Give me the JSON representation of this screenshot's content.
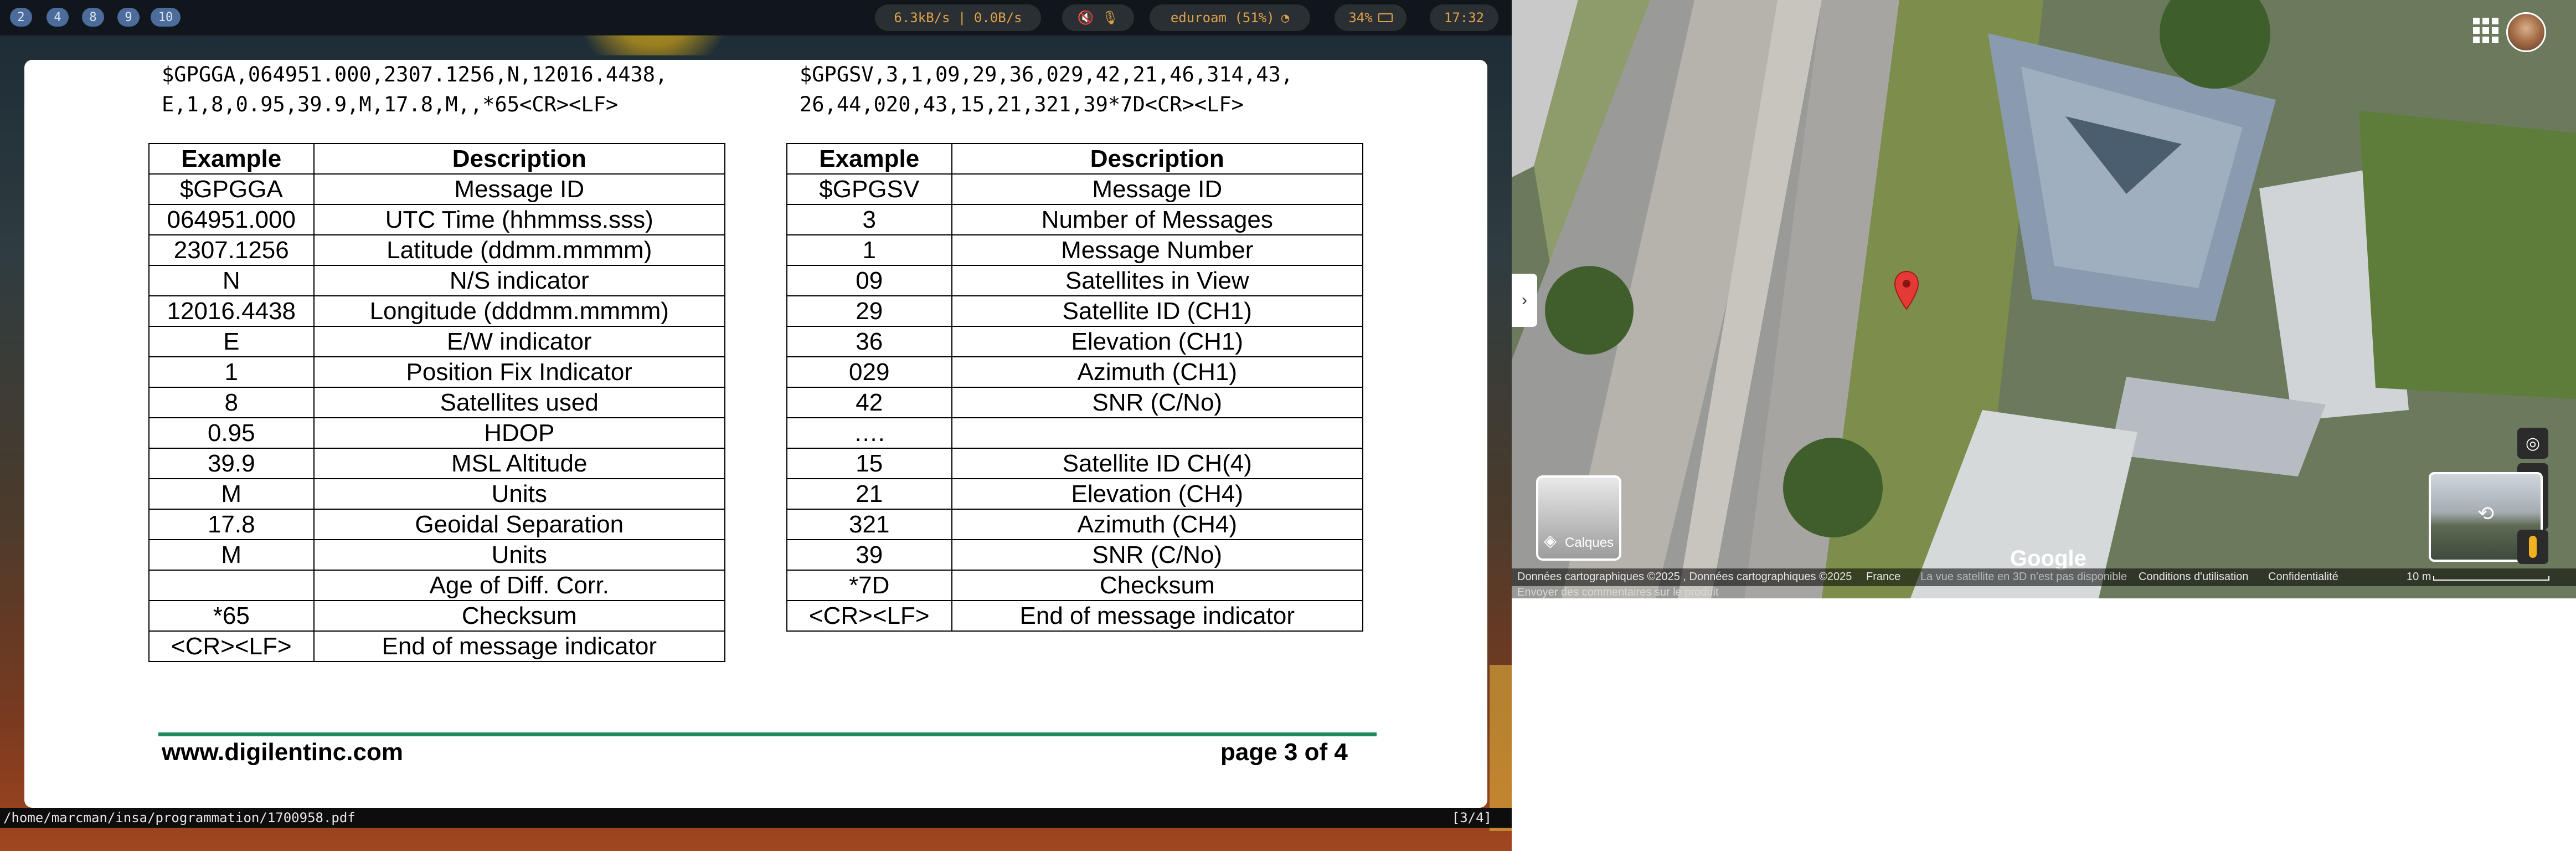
{
  "topbar": {
    "workspaces": [
      "2",
      "4",
      "8",
      "9",
      "10"
    ],
    "network_speed": "6.3kB/s | 0.0B/s",
    "wifi": "eduroam (51%)",
    "battery": "34%",
    "clock": "17:32"
  },
  "pdf": {
    "nmea_left": [
      "$GPGGA,064951.000,2307.1256,N,12016.4438,",
      "E,1,8,0.95,39.9,M,17.8,M,,*65<CR><LF>"
    ],
    "nmea_right": [
      "$GPGSV,3,1,09,29,36,029,42,21,46,314,43,",
      "26,44,020,43,15,21,321,39*7D<CR><LF>"
    ],
    "headers": {
      "example": "Example",
      "description": "Description"
    },
    "gga_rows": [
      [
        "$GPGGA",
        "Message ID"
      ],
      [
        "064951.000",
        "UTC Time (hhmmss.sss)"
      ],
      [
        "2307.1256",
        "Latitude (ddmm.mmmm)"
      ],
      [
        "N",
        "N/S indicator"
      ],
      [
        "12016.4438",
        "Longitude (dddmm.mmmm)"
      ],
      [
        "E",
        "E/W indicator"
      ],
      [
        "1",
        "Position Fix Indicator"
      ],
      [
        "8",
        "Satellites used"
      ],
      [
        "0.95",
        "HDOP"
      ],
      [
        "39.9",
        "MSL Altitude"
      ],
      [
        "M",
        "Units"
      ],
      [
        "17.8",
        "Geoidal Separation"
      ],
      [
        "M",
        "Units"
      ],
      [
        "",
        "Age of Diff. Corr."
      ],
      [
        "*65",
        "Checksum"
      ],
      [
        "<CR><LF>",
        "End of message indicator"
      ]
    ],
    "gsv_rows": [
      [
        "$GPGSV",
        "Message ID"
      ],
      [
        "3",
        "Number of Messages"
      ],
      [
        "1",
        "Message Number"
      ],
      [
        "09",
        "Satellites in View"
      ],
      [
        "29",
        "Satellite ID (CH1)"
      ],
      [
        "36",
        "Elevation (CH1)"
      ],
      [
        "029",
        "Azimuth (CH1)"
      ],
      [
        "42",
        "SNR (C/No)"
      ],
      [
        "….",
        ""
      ],
      [
        "15",
        "Satellite ID CH(4)"
      ],
      [
        "21",
        "Elevation (CH4)"
      ],
      [
        "321",
        "Azimuth (CH4)"
      ],
      [
        "39",
        "SNR (C/No)"
      ],
      [
        "*7D",
        "Checksum"
      ],
      [
        "<CR><LF>",
        "End of message indicator"
      ]
    ],
    "footer_site": "www.digilentinc.com",
    "footer_page": "page 3 of 4"
  },
  "statusbar": {
    "path": "/home/marcman/insa/programmation/1700958.pdf",
    "pages": "[3/4]"
  },
  "map": {
    "layers_label": "Calques",
    "google_logo": "Google",
    "attribution": "Données cartographiques ©2025 , Données cartographiques ©2025",
    "country": "France",
    "satellite_3d_note": "La vue satellite en 3D n'est pas disponible",
    "terms": "Conditions d'utilisation",
    "privacy": "Confidentialité",
    "feedback": "Envoyer des commentaires sur le produit",
    "scale": "10 m",
    "pin_color": "#e53935"
  }
}
